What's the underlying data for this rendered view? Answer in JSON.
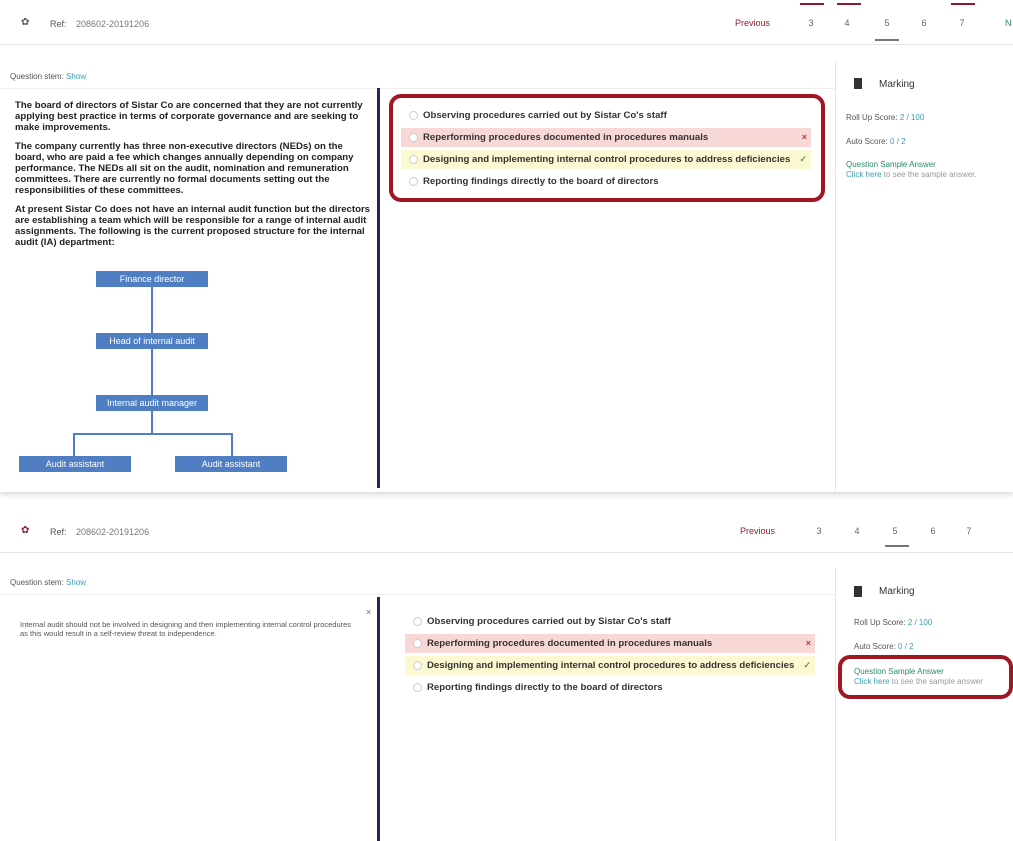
{
  "header": {
    "ref_label": "Ref:",
    "ref_value": "208602-20191206",
    "previous_label": "Previous",
    "next_label": "N",
    "pages": [
      "3",
      "4",
      "5",
      "6",
      "7"
    ]
  },
  "question_stem": {
    "label": "Question stem:",
    "show_label": "Show"
  },
  "question_text": [
    "The board of directors of Sistar Co are concerned that they are not currently applying best practice in terms of corporate governance and are seeking to make improvements.",
    "The company currently has three non-executive directors (NEDs) on the board, who are paid a fee which changes annually depending on company performance. The NEDs all sit on the audit, nomination and remuneration committees. There are currently no formal documents setting out the responsibilities of these committees.",
    "At present Sistar Co does not have an internal audit function but the directors are establishing a team which will be responsible for a range of internal audit assignments. The following is the current proposed structure for the internal audit (IA) department:"
  ],
  "org_chart": {
    "finance_director": "Finance director",
    "head_ia": "Head of internal audit",
    "ia_manager": "Internal  audit manager",
    "assistant_1": "Audit assistant",
    "assistant_2": "Audit assistant"
  },
  "options": [
    {
      "text": "Observing procedures carried out by Sistar Co's staff",
      "state": "none",
      "mark": ""
    },
    {
      "text": "Reperforming procedures documented in procedures manuals",
      "state": "wrong",
      "mark": "×"
    },
    {
      "text": "Designing and implementing internal control procedures to address deficiencies",
      "state": "correct",
      "mark": "✓"
    },
    {
      "text": "Reporting findings directly to the board of directors",
      "state": "none",
      "mark": ""
    }
  ],
  "sidebar": {
    "marking_title": "Marking",
    "rollup_label": "Roll Up Score:",
    "rollup_value": "2 / 100",
    "auto_label": "Auto Score:",
    "auto_value": "0 / 2",
    "sample_title": "Question Sample Answer",
    "click_here": "Click here",
    "sample_rest_top": " to see the sample answer.",
    "sample_rest_bottom": " to see the sample answer"
  },
  "explanation": {
    "text": "Internal audit should not be involved in designing and then implementing internal control procedures as this would result in a self-review threat to independence.",
    "close": "×"
  },
  "colors": {
    "accent": "#8a1c2c",
    "highlight_box": "#a01622",
    "org_box": "#4f7fc2",
    "wrong_bg": "#f8d7d7",
    "correct_bg": "#fbf8d2",
    "link": "#3a9fb0"
  },
  "icons": {
    "settings": "gear-icon",
    "marking": "document-icon",
    "wrong": "cross-icon",
    "correct": "check-icon"
  }
}
